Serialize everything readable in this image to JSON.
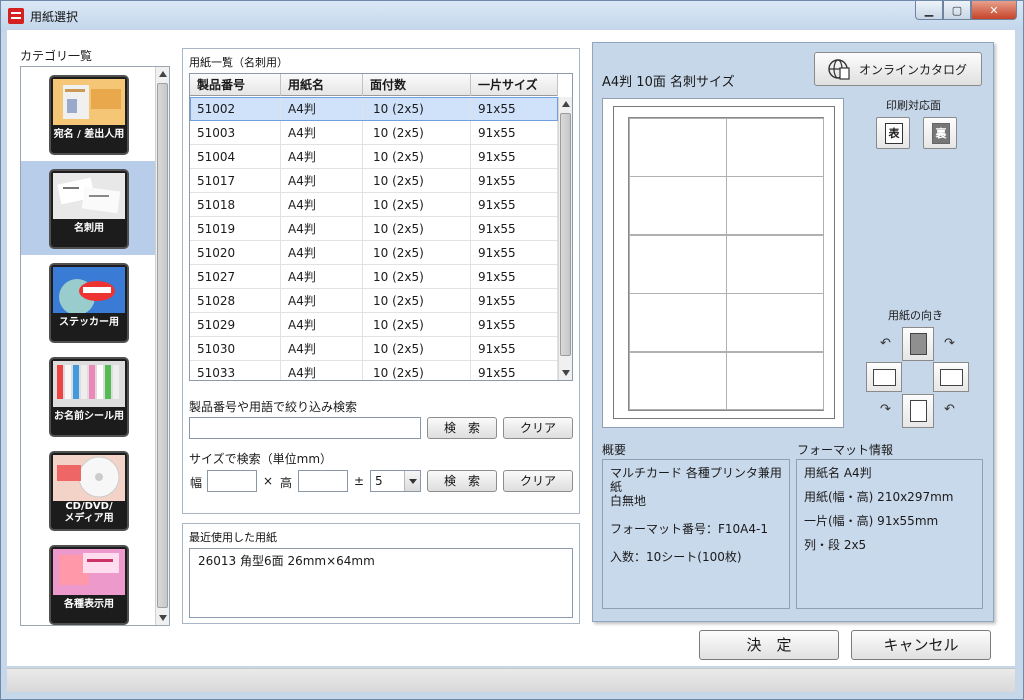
{
  "window": {
    "title": "用紙選択"
  },
  "category": {
    "label": "カテゴリ一覧",
    "items": [
      {
        "label": "宛名 / 差出人用",
        "selected": false
      },
      {
        "label": "名刺用",
        "selected": true
      },
      {
        "label": "ステッカー用",
        "selected": false
      },
      {
        "label": "お名前シール用",
        "selected": false
      },
      {
        "label": "CD/DVD/\nメディア用",
        "selected": false
      },
      {
        "label": "各種表示用",
        "selected": false
      }
    ]
  },
  "paper_list": {
    "group_title": "用紙一覧（名刺用）",
    "columns": [
      "製品番号",
      "用紙名",
      "面付数",
      "一片サイズ"
    ],
    "rows": [
      [
        "51002",
        "A4判",
        "10 (2x5)",
        "91x55"
      ],
      [
        "51003",
        "A4判",
        "10 (2x5)",
        "91x55"
      ],
      [
        "51004",
        "A4判",
        "10 (2x5)",
        "91x55"
      ],
      [
        "51017",
        "A4判",
        "10 (2x5)",
        "91x55"
      ],
      [
        "51018",
        "A4判",
        "10 (2x5)",
        "91x55"
      ],
      [
        "51019",
        "A4判",
        "10 (2x5)",
        "91x55"
      ],
      [
        "51020",
        "A4判",
        "10 (2x5)",
        "91x55"
      ],
      [
        "51027",
        "A4判",
        "10 (2x5)",
        "91x55"
      ],
      [
        "51028",
        "A4判",
        "10 (2x5)",
        "91x55"
      ],
      [
        "51029",
        "A4判",
        "10 (2x5)",
        "91x55"
      ],
      [
        "51030",
        "A4判",
        "10 (2x5)",
        "91x55"
      ],
      [
        "51033",
        "A4判",
        "10 (2x5)",
        "91x55"
      ]
    ],
    "selected_row": 0
  },
  "filter": {
    "label": "製品番号や用語で絞り込み検索",
    "value": "",
    "search_label": "検　索",
    "clear_label": "クリア"
  },
  "size_search": {
    "label": "サイズで検索（単位mm）",
    "width_label": "幅",
    "times": "×",
    "height_label": "高",
    "pm": "±",
    "width_value": "",
    "height_value": "",
    "tolerance": "5",
    "search_label": "検　索",
    "clear_label": "クリア"
  },
  "recent": {
    "title": "最近使用した用紙",
    "items": [
      "26013 角型6面 26mm×64mm"
    ]
  },
  "detail": {
    "paper_title": "A4判 10面 名刺サイズ",
    "online_catalog": "オンラインカタログ",
    "print_side_label": "印刷対応面",
    "front": "表",
    "back": "裏",
    "orientation_label": "用紙の向き",
    "summary_title": "概要",
    "summary_lines": [
      "マルチカード 各種プリンタ兼用",
      "紙",
      "白無地",
      "",
      "フォーマット番号：F10A4-1",
      "",
      "入数：10シート(100枚)"
    ],
    "format_title": "フォーマット情報",
    "format_lines": [
      "用紙名  A4判",
      "用紙(幅・高)  210x297mm",
      "一片(幅・高)  91x55mm",
      "列・段  2x5"
    ]
  },
  "actions": {
    "ok": "決　定",
    "cancel": "キャンセル"
  }
}
